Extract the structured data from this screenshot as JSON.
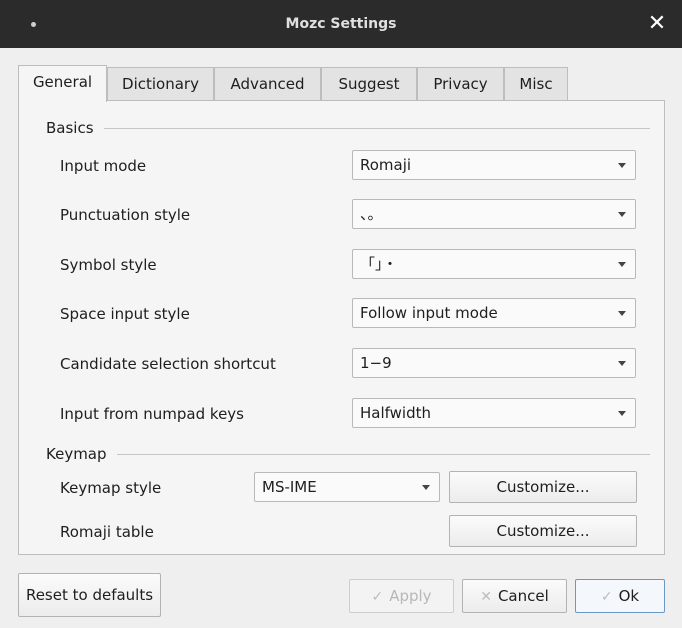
{
  "window": {
    "title": "Mozc Settings",
    "close_icon": "close-icon"
  },
  "tabs": [
    {
      "label": "General",
      "active": true
    },
    {
      "label": "Dictionary",
      "active": false
    },
    {
      "label": "Advanced",
      "active": false
    },
    {
      "label": "Suggest",
      "active": false
    },
    {
      "label": "Privacy",
      "active": false
    },
    {
      "label": "Misc",
      "active": false
    }
  ],
  "basics": {
    "title": "Basics",
    "input_mode": {
      "label": "Input mode",
      "value": "Romaji"
    },
    "punctuation_style": {
      "label": "Punctuation style",
      "value": "、。"
    },
    "symbol_style": {
      "label": "Symbol style",
      "value": "「」・"
    },
    "space_input_style": {
      "label": "Space input style",
      "value": "Follow input mode"
    },
    "candidate_selection_shortcut": {
      "label": "Candidate selection shortcut",
      "value": "1−9"
    },
    "input_from_numpad_keys": {
      "label": "Input from numpad keys",
      "value": "Halfwidth"
    }
  },
  "keymap": {
    "title": "Keymap",
    "keymap_style": {
      "label": "Keymap style",
      "value": "MS-IME",
      "button": "Customize..."
    },
    "romaji_table": {
      "label": "Romaji table",
      "button": "Customize..."
    }
  },
  "footer": {
    "reset": "Reset to defaults",
    "apply": "Apply",
    "cancel": "Cancel",
    "ok": "Ok"
  }
}
